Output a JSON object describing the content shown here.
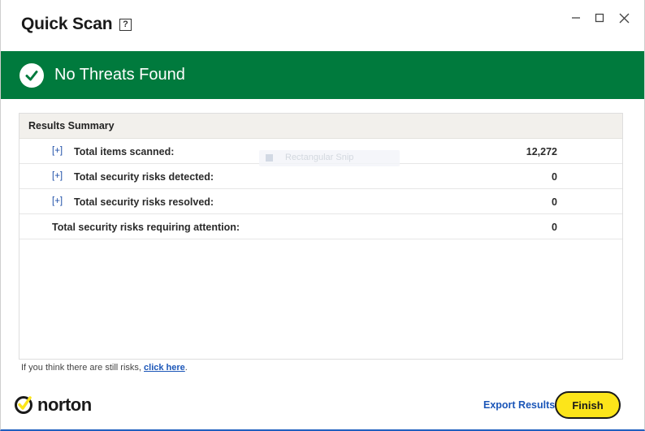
{
  "window": {
    "title": "Quick Scan",
    "help_glyph": "?",
    "controls": [
      "minimize-icon",
      "maximize-icon",
      "close-icon"
    ]
  },
  "banner": {
    "text": "No Threats Found",
    "icon": "checkmark-circle-icon",
    "color": "#007a3d"
  },
  "results": {
    "header": "Results Summary",
    "expand_glyph": "[+]",
    "rows": [
      {
        "label": "Total items scanned:",
        "value": "12,272",
        "expandable": true
      },
      {
        "label": "Total security risks detected:",
        "value": "0",
        "expandable": true
      },
      {
        "label": "Total security risks resolved:",
        "value": "0",
        "expandable": true
      },
      {
        "label": "Total security risks requiring attention:",
        "value": "0",
        "expandable": false
      }
    ],
    "ghost_text": "Rectangular Snip"
  },
  "footer": {
    "note_prefix": "If you think there are still risks,",
    "note_link": "click here",
    "note_suffix": "."
  },
  "bottom": {
    "logo_text": "norton",
    "export_label": "Export Results",
    "finish_label": "Finish",
    "accent": "#fce51a",
    "link_color": "#1b56b8"
  }
}
